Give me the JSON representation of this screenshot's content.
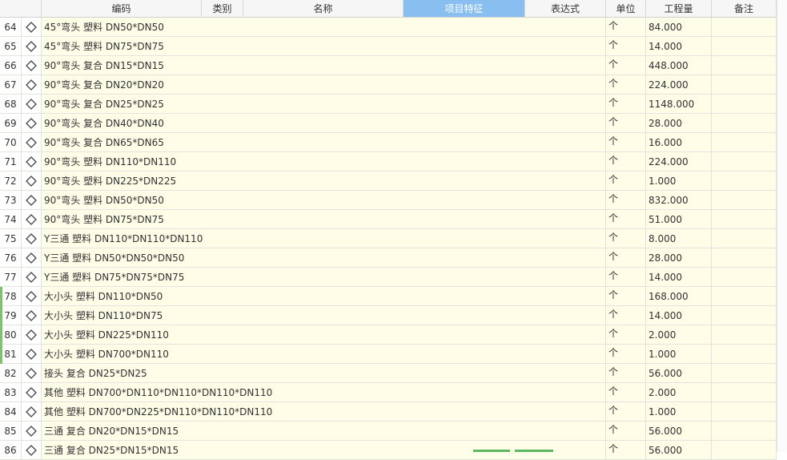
{
  "columns": {
    "code": "编码",
    "category": "类别",
    "name": "名称",
    "feature": "项目特征",
    "expression": "表达式",
    "unit": "单位",
    "quantity": "工程量",
    "note": "备注"
  },
  "colors": {
    "active_header": "#88bff0",
    "row_bg": "#fefde8",
    "marker": "#7cc36a"
  },
  "rows": [
    {
      "num": "64",
      "name": "45°弯头 塑料 DN50*DN50",
      "unit": "个",
      "qty": "84.000"
    },
    {
      "num": "65",
      "name": "45°弯头 塑料 DN75*DN75",
      "unit": "个",
      "qty": "14.000"
    },
    {
      "num": "66",
      "name": "90°弯头 复合 DN15*DN15",
      "unit": "个",
      "qty": "448.000"
    },
    {
      "num": "67",
      "name": "90°弯头 复合 DN20*DN20",
      "unit": "个",
      "qty": "224.000"
    },
    {
      "num": "68",
      "name": "90°弯头 复合 DN25*DN25",
      "unit": "个",
      "qty": "1148.000"
    },
    {
      "num": "69",
      "name": "90°弯头 复合 DN40*DN40",
      "unit": "个",
      "qty": "28.000"
    },
    {
      "num": "70",
      "name": "90°弯头 复合 DN65*DN65",
      "unit": "个",
      "qty": "16.000"
    },
    {
      "num": "71",
      "name": "90°弯头 塑料 DN110*DN110",
      "unit": "个",
      "qty": "224.000"
    },
    {
      "num": "72",
      "name": "90°弯头 塑料 DN225*DN225",
      "unit": "个",
      "qty": "1.000"
    },
    {
      "num": "73",
      "name": "90°弯头 塑料 DN50*DN50",
      "unit": "个",
      "qty": "832.000"
    },
    {
      "num": "74",
      "name": "90°弯头 塑料 DN75*DN75",
      "unit": "个",
      "qty": "51.000"
    },
    {
      "num": "75",
      "name": "Y三通 塑料 DN110*DN110*DN110",
      "unit": "个",
      "qty": "8.000"
    },
    {
      "num": "76",
      "name": "Y三通 塑料 DN50*DN50*DN50",
      "unit": "个",
      "qty": "28.000"
    },
    {
      "num": "77",
      "name": "Y三通 塑料 DN75*DN75*DN75",
      "unit": "个",
      "qty": "14.000"
    },
    {
      "num": "78",
      "name": "大小头 塑料 DN110*DN50",
      "unit": "个",
      "qty": "168.000",
      "mark": true
    },
    {
      "num": "79",
      "name": "大小头 塑料 DN110*DN75",
      "unit": "个",
      "qty": "14.000",
      "mark": true
    },
    {
      "num": "80",
      "name": "大小头 塑料 DN225*DN110",
      "unit": "个",
      "qty": "2.000",
      "mark": true
    },
    {
      "num": "81",
      "name": "大小头 塑料 DN700*DN110",
      "unit": "个",
      "qty": "1.000",
      "mark": true
    },
    {
      "num": "82",
      "name": "接头 复合 DN25*DN25",
      "unit": "个",
      "qty": "56.000"
    },
    {
      "num": "83",
      "name": "其他 塑料 DN700*DN110*DN110*DN110*DN110",
      "unit": "个",
      "qty": "2.000"
    },
    {
      "num": "84",
      "name": "其他 塑料 DN700*DN225*DN110*DN110*DN110",
      "unit": "个",
      "qty": "1.000"
    },
    {
      "num": "85",
      "name": "三通 复合 DN20*DN15*DN15",
      "unit": "个",
      "qty": "56.000"
    },
    {
      "num": "86",
      "name": "三通 复合 DN25*DN15*DN15",
      "unit": "个",
      "qty": "56.000"
    }
  ]
}
